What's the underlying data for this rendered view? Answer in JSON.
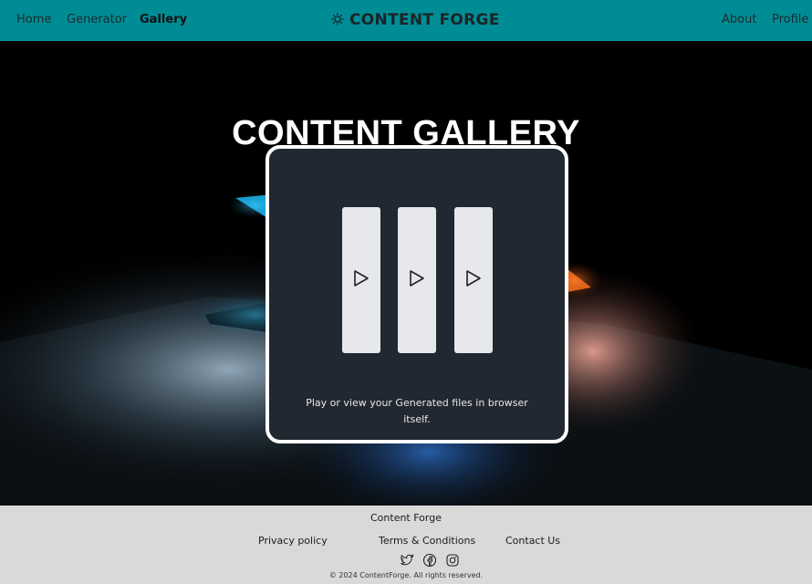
{
  "nav": {
    "links_left": [
      "Home",
      "Generator",
      "Gallery"
    ],
    "active": "Gallery",
    "brand": "CONTENT FORGE",
    "brand_icon": "sun-icon",
    "links_right": [
      "About",
      "Profile"
    ]
  },
  "hero": {
    "title": "CONTENT GALLERY",
    "card": {
      "description": "Play or view your Generated files in browser itself.",
      "tiles": [
        {
          "icon": "play-icon"
        },
        {
          "icon": "play-icon"
        },
        {
          "icon": "play-icon"
        }
      ]
    }
  },
  "footer": {
    "brand": "Content Forge",
    "links": [
      "Privacy policy",
      "Terms & Conditions",
      "Contact Us"
    ],
    "social": [
      "twitter-icon",
      "facebook-icon",
      "instagram-icon"
    ],
    "copyright": "© 2024 ContentForge. All rights reserved."
  },
  "colors": {
    "nav_bg": "#008c95",
    "card_bg": "#222831",
    "footer_bg": "#d9d9d9"
  }
}
